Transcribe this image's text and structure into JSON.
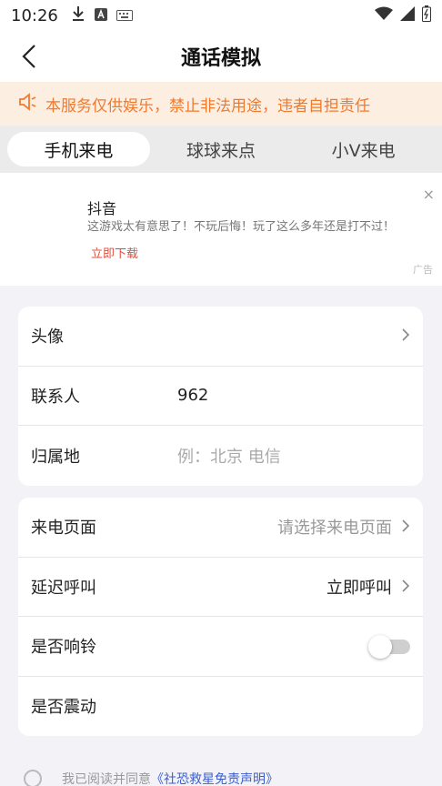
{
  "status": {
    "time": "10:26"
  },
  "nav": {
    "title": "通话模拟"
  },
  "notice": {
    "text": "本服务仅供娱乐，禁止非法用途，违者自担责任"
  },
  "tabs": [
    {
      "label": "手机来电",
      "active": true
    },
    {
      "label": "球球来点",
      "active": false
    },
    {
      "label": "小V来电",
      "active": false
    }
  ],
  "ad": {
    "title": "抖音",
    "desc": "这游戏太有意思了！不玩后悔！玩了这么多年还是打不过！",
    "cta": "立即下载",
    "badge": "广告",
    "close": "×"
  },
  "form1": {
    "avatar_label": "头像",
    "contact_label": "联系人",
    "contact_value": "962",
    "location_label": "归属地",
    "location_placeholder": "例：北京 电信"
  },
  "form2": {
    "page_label": "来电页面",
    "page_placeholder": "请选择来电页面",
    "delay_label": "延迟呼叫",
    "delay_value": "立即呼叫",
    "ring_label": "是否响铃",
    "ring_on": false,
    "vibrate_label": "是否震动"
  },
  "agree": {
    "prefix": "我已阅读并同意",
    "link": "《社恐救星免责声明》"
  },
  "colors": {
    "accent": "#f07a2e",
    "link": "#3a5fcf",
    "cta": "#e24b3b"
  }
}
